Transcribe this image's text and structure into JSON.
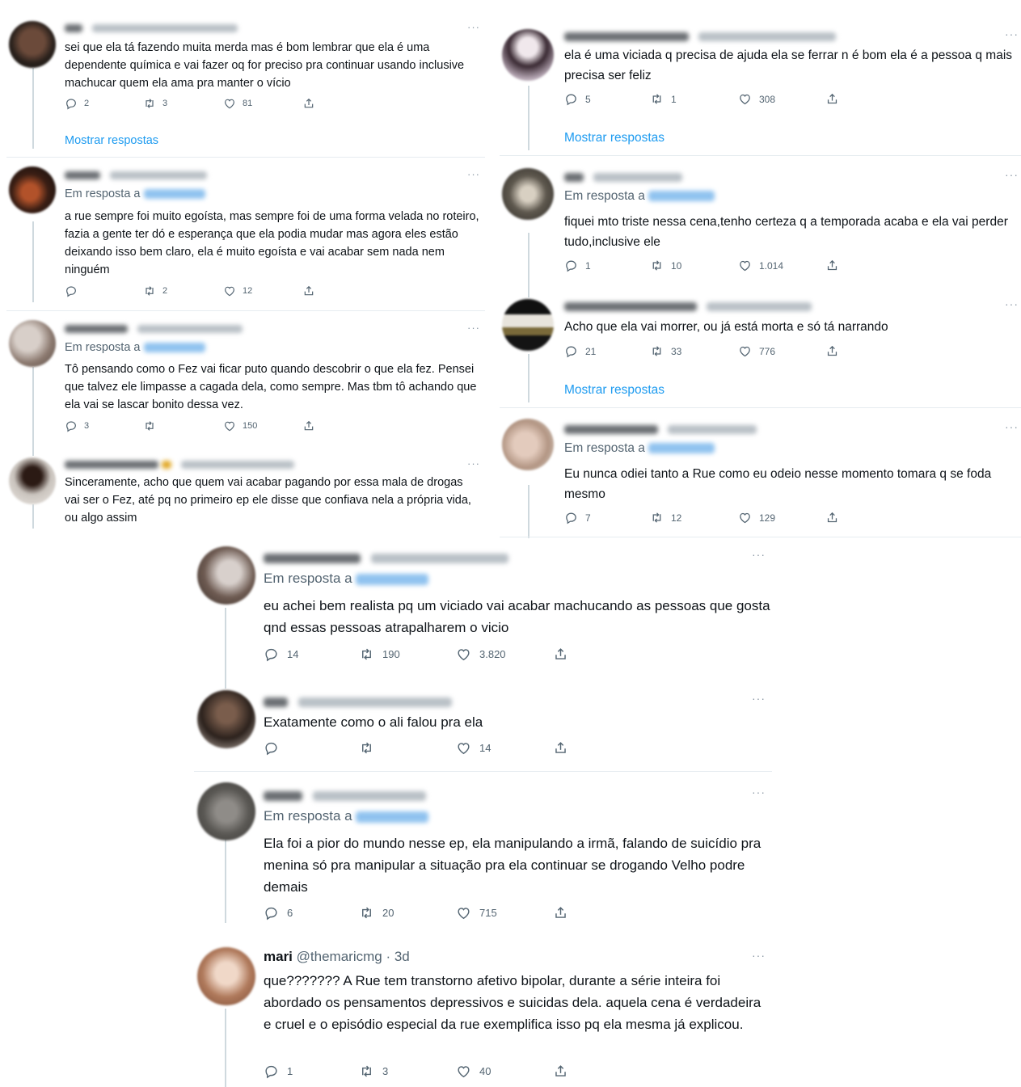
{
  "accent_color": "#1d9bf0",
  "icons": {
    "reply": "speech-bubble-icon",
    "retweet": "retweet-arrows-icon",
    "like": "heart-icon",
    "share": "share-upload-icon",
    "more": "ellipsis-icon"
  },
  "ui": {
    "reply_prefix": "Em resposta a",
    "show_replies": "Mostrar respostas",
    "more": "···"
  },
  "left_panel": {
    "tweets": [
      {
        "text": "sei que ela tá fazendo muita merda mas é bom lembrar que ela é uma dependente química e vai fazer oq for preciso pra continuar usando inclusive machucar quem ela ama pra manter o vício",
        "replies": "2",
        "retweets": "3",
        "likes": "81",
        "has_reply_to": false
      },
      {
        "text": "a rue sempre foi muito egoísta, mas sempre foi de uma forma velada no roteiro, fazia a gente ter dó e esperança que ela podia mudar mas agora eles estão deixando isso bem claro, ela é muito egoísta e vai acabar sem nada nem ninguém",
        "replies": "",
        "retweets": "2",
        "likes": "12",
        "has_reply_to": true
      },
      {
        "text": "Tô pensando como o Fez vai ficar puto quando descobrir o que ela fez. Pensei que talvez ele limpasse a cagada dela, como sempre. Mas tbm tô achando que ela vai se lascar bonito dessa vez.",
        "replies": "3",
        "retweets": "",
        "likes": "150",
        "has_reply_to": true
      },
      {
        "text": "Sinceramente, acho que quem vai acabar pagando por essa mala de drogas vai ser o Fez, até pq no primeiro ep ele disse que confiava nela a própria vida, ou algo assim",
        "has_reply_to": false
      }
    ]
  },
  "right_panel": {
    "tweets": [
      {
        "text": "ela é uma viciada q precisa de ajuda ela se ferrar n é bom ela é a pessoa q mais precisa ser feliz",
        "replies": "5",
        "retweets": "1",
        "likes": "308",
        "has_reply_to": false
      },
      {
        "text": "fiquei mto triste nessa cena,tenho certeza q a temporada acaba e ela vai perder tudo,inclusive ele",
        "replies": "1",
        "retweets": "10",
        "likes": "1.014",
        "has_reply_to": true
      },
      {
        "text": "Acho que ela vai morrer, ou já está morta e só tá narrando",
        "replies": "21",
        "retweets": "33",
        "likes": "776",
        "has_reply_to": false
      },
      {
        "text": "Eu nunca odiei tanto a Rue como eu odeio nesse momento tomara q se foda mesmo",
        "replies": "7",
        "retweets": "12",
        "likes": "129",
        "has_reply_to": true
      }
    ]
  },
  "bottom_panel": {
    "tweets": [
      {
        "text": "eu achei bem realista pq um viciado vai acabar machucando as pessoas que gosta qnd essas pessoas atrapalharem o vicio",
        "replies": "14",
        "retweets": "190",
        "likes": "3.820",
        "has_reply_to": true
      },
      {
        "text": "Exatamente como o ali falou pra ela",
        "replies": "",
        "retweets": "",
        "likes": "14",
        "has_reply_to": false
      },
      {
        "text": "Ela foi a pior do mundo nesse ep, ela manipulando a irmã, falando de suicídio pra menina só pra manipular a situação pra ela continuar se drogando Velho podre demais",
        "replies": "6",
        "retweets": "20",
        "likes": "715",
        "has_reply_to": true
      },
      {
        "name": "mari",
        "handle": "@themaricmg",
        "time": "· 3d",
        "text": "que??????? A Rue tem transtorno afetivo bipolar, durante a série inteira foi abordado os pensamentos depressivos e suicidas dela. aquela cena é verdadeira e cruel e o episódio especial da rue exemplifica isso pq ela mesma já explicou.",
        "replies": "1",
        "retweets": "3",
        "likes": "40",
        "has_reply_to": false
      }
    ]
  }
}
